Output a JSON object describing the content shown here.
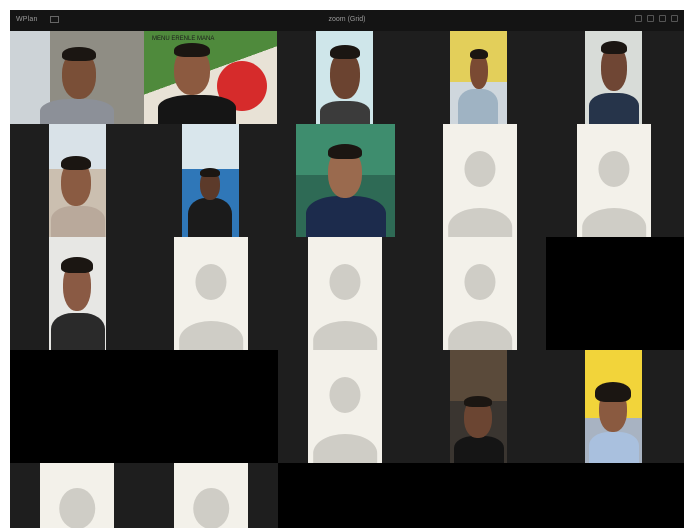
{
  "window": {
    "app_name": "WPlan",
    "title": "zoom (Grid)",
    "controls": [
      "minimize-icon",
      "restore-icon",
      "maximize-icon",
      "close-icon"
    ]
  },
  "participants": [
    {
      "id": "video-1",
      "kind": "video"
    },
    {
      "id": "video-2",
      "kind": "video",
      "visible_text": "MENU  ERENLE MANA"
    },
    {
      "id": "video-3",
      "kind": "video"
    },
    {
      "id": "video-4",
      "kind": "video"
    },
    {
      "id": "video-5",
      "kind": "video"
    },
    {
      "id": "video-6",
      "kind": "video"
    },
    {
      "id": "video-7",
      "kind": "video"
    },
    {
      "id": "video-8",
      "kind": "video"
    },
    {
      "id": "avatar-1",
      "kind": "avatar",
      "icon": "person-avatar-icon"
    },
    {
      "id": "avatar-2",
      "kind": "avatar",
      "icon": "person-avatar-icon"
    },
    {
      "id": "video-9",
      "kind": "video"
    },
    {
      "id": "avatar-3",
      "kind": "avatar",
      "icon": "person-avatar-icon"
    },
    {
      "id": "avatar-4",
      "kind": "avatar",
      "icon": "person-avatar-icon"
    },
    {
      "id": "avatar-5",
      "kind": "avatar",
      "icon": "person-avatar-icon"
    },
    {
      "id": "avatar-6",
      "kind": "avatar",
      "icon": "person-avatar-icon"
    },
    {
      "id": "video-10",
      "kind": "video"
    },
    {
      "id": "video-11",
      "kind": "video"
    },
    {
      "id": "avatar-7",
      "kind": "avatar",
      "icon": "person-avatar-icon"
    },
    {
      "id": "avatar-8",
      "kind": "avatar",
      "icon": "person-avatar-icon"
    }
  ],
  "colors": {
    "window_bg": "#1e1e1e",
    "titlebar": "#141414",
    "placeholder_bg": "#f3f1ea",
    "avatar_gray": "#cfcdc6"
  }
}
